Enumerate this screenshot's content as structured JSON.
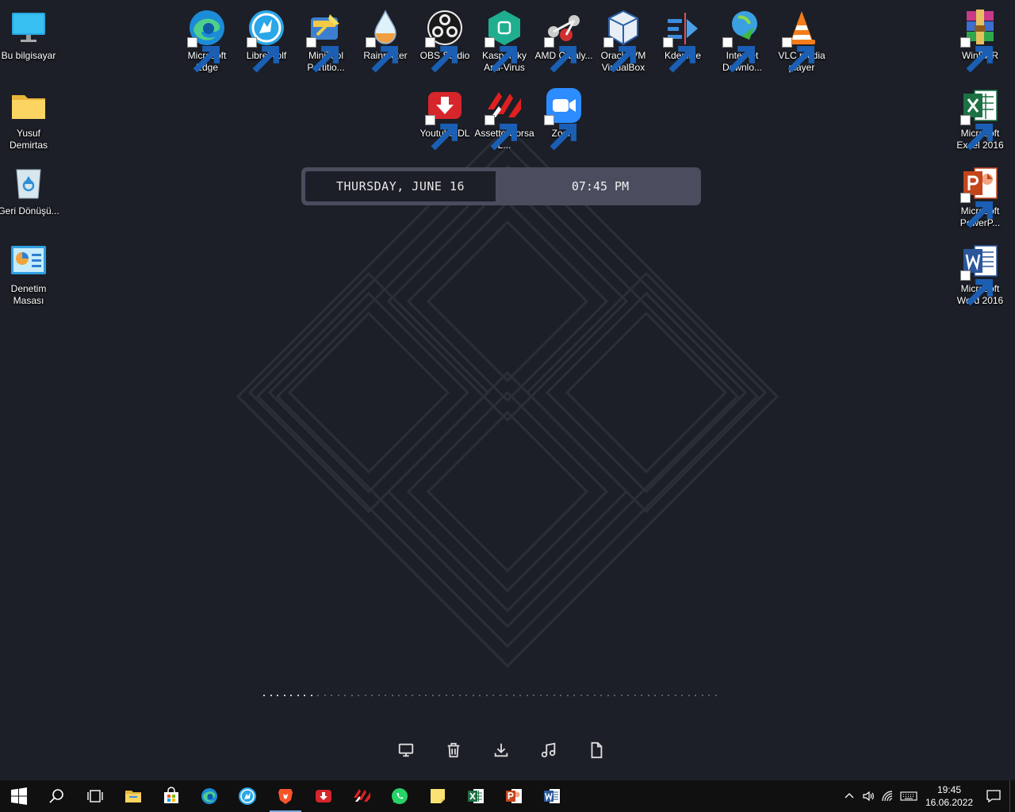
{
  "desktop": {
    "left_icons": [
      {
        "label": "Bu bilgisayar",
        "icon": "monitor-icon"
      },
      {
        "label": "Yusuf Demirtas",
        "icon": "folder-icon"
      },
      {
        "label": "Geri Dönüşü...",
        "icon": "recycle-bin-icon"
      },
      {
        "label": "Denetim Masası",
        "icon": "control-panel-icon"
      }
    ],
    "top_icons": [
      {
        "label": "Microsoft Edge",
        "icon": "edge-icon"
      },
      {
        "label": "LibreWolf",
        "icon": "librewolf-icon"
      },
      {
        "label": "MiniTool Partitio...",
        "icon": "minitool-icon"
      },
      {
        "label": "Rainmeter",
        "icon": "rainmeter-icon"
      },
      {
        "label": "OBS Studio",
        "icon": "obs-icon"
      },
      {
        "label": "Kaspersky Anti-Virus",
        "icon": "kaspersky-icon"
      },
      {
        "label": "AMD Cataly...",
        "icon": "amd-icon"
      },
      {
        "label": "Oracle VM VirtualBox",
        "icon": "virtualbox-icon"
      },
      {
        "label": "Kdenlive",
        "icon": "kdenlive-icon"
      },
      {
        "label": "Internet Downlo...",
        "icon": "idm-icon"
      },
      {
        "label": "VLC media player",
        "icon": "vlc-icon"
      },
      {
        "label": "Youtube-DL",
        "icon": "youtube-dl-icon"
      },
      {
        "label": "Assetto Corsa L...",
        "icon": "assetto-corsa-icon"
      },
      {
        "label": "Zoom",
        "icon": "zoom-icon"
      }
    ],
    "right_icons": [
      {
        "label": "WinRAR",
        "icon": "winrar-icon"
      },
      {
        "label": "Microsoft Excel 2016",
        "icon": "excel-icon"
      },
      {
        "label": "Microsoft PowerP...",
        "icon": "powerpoint-icon"
      },
      {
        "label": "Microsoft Word 2016",
        "icon": "word-icon"
      }
    ]
  },
  "widget": {
    "date": "THURSDAY, JUNE 16",
    "time": "07:45 PM",
    "progress_dots_total": 68,
    "progress_dots_active": 8
  },
  "dock": [
    "monitor-icon",
    "trash-icon",
    "download-icon",
    "music-icon",
    "document-icon"
  ],
  "taskbar": {
    "apps": [
      "windows-start-icon",
      "search-icon",
      "task-view-icon",
      "file-explorer-icon",
      "store-icon",
      "edge-icon",
      "librewolf-icon",
      "brave-icon",
      "youtube-dl-icon",
      "assetto-corsa-icon",
      "whatsapp-icon",
      "sticky-notes-icon",
      "excel-icon",
      "powerpoint-icon",
      "word-icon"
    ],
    "active_app": "brave-icon",
    "time": "19:45",
    "date": "16.06.2022"
  }
}
